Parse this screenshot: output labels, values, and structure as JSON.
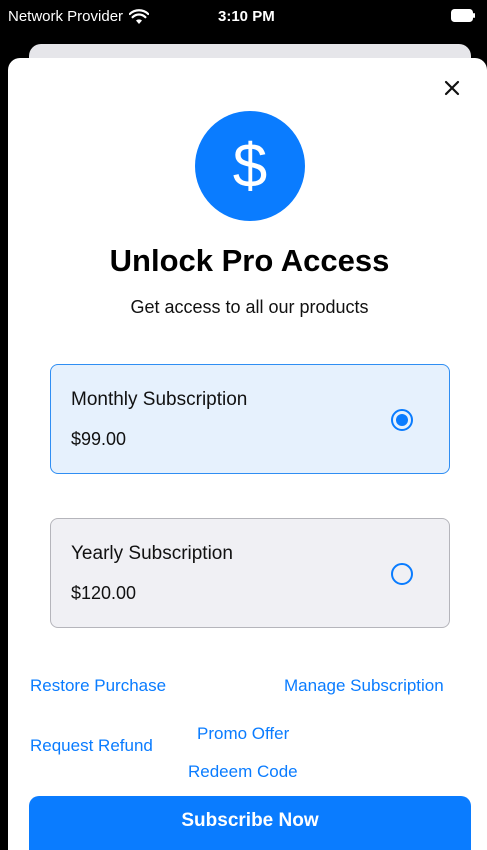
{
  "status_bar": {
    "carrier": "Network Provider",
    "time": "3:10 PM"
  },
  "icons": {
    "close": "close-icon",
    "dollar": "dollar-icon",
    "wifi": "wifi-icon",
    "battery": "battery-icon"
  },
  "badge": {
    "symbol": "$"
  },
  "header": {
    "title": "Unlock Pro Access",
    "subtitle": "Get access to all our products"
  },
  "plans": [
    {
      "name": "Monthly Subscription",
      "price": "$99.00",
      "selected": true
    },
    {
      "name": "Yearly Subscription",
      "price": "$120.00",
      "selected": false
    }
  ],
  "links": {
    "restore": "Restore Purchase",
    "manage": "Manage Subscription",
    "refund": "Request Refund",
    "promo": "Promo Offer",
    "redeem": "Redeem Code"
  },
  "cta": {
    "label": "Subscribe Now"
  },
  "colors": {
    "accent": "#0a7cff",
    "selected_card_bg": "#e6f1fd",
    "unselected_card_bg": "#f0f0f4"
  }
}
